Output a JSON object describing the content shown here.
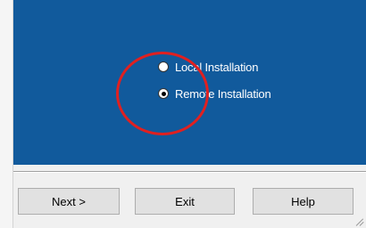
{
  "options": [
    {
      "label": "Local Installation",
      "checked": false
    },
    {
      "label": "Remote Installation",
      "checked": true
    }
  ],
  "buttons": {
    "next": "Next >",
    "exit": "Exit",
    "help": "Help"
  },
  "colors": {
    "panel_background": "#115a9c",
    "annotation_circle": "#e02020"
  }
}
